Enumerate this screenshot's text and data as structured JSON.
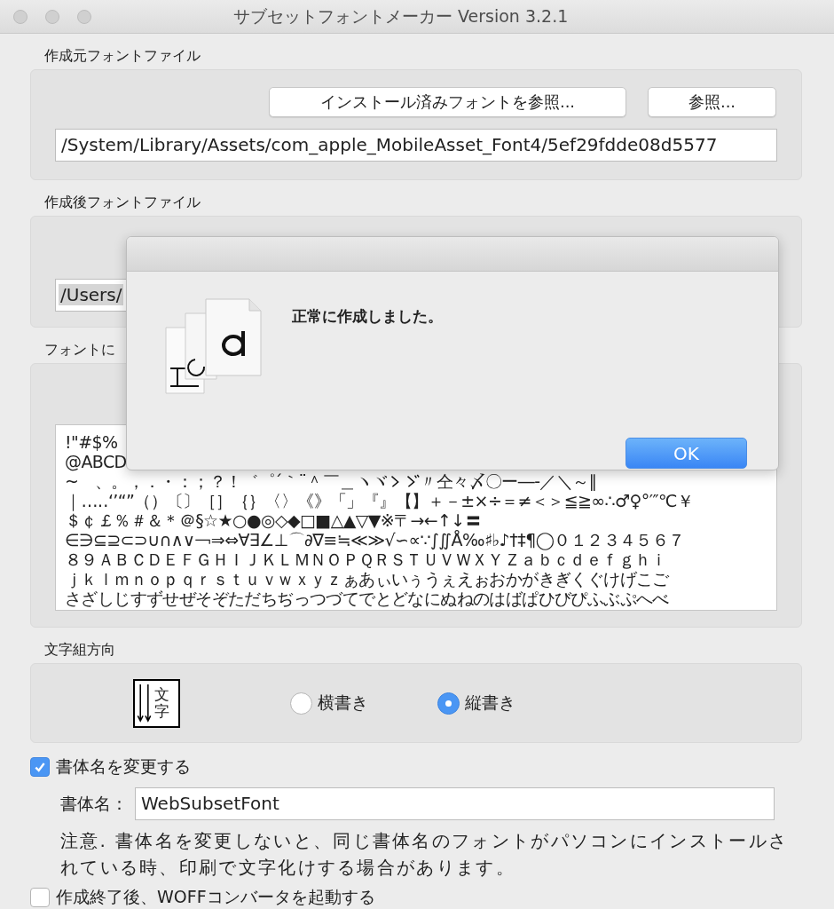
{
  "window": {
    "title": "サブセットフォントメーカー Version 3.2.1"
  },
  "source_section": {
    "label": "作成元フォントファイル",
    "buttons": [
      "インストール済みフォントを参照...",
      "参照..."
    ],
    "path": "/System/Library/Assets/com_apple_MobileAsset_Font4/5ef29fdde08d5577"
  },
  "output_section": {
    "label": "作成後フォントファイル",
    "path": "/Users/"
  },
  "chars_section": {
    "label": "フォントに",
    "lines": [
      "!\"#$%",
      "@ABCD",
      {
        "kind": "split",
        "before": "~　、。，．・：；？！゛゜´｀¨＾￣＿ヽヾ",
        "after": "〃仝々〆〇ー―‐／＼～∥"
      },
      "｜…‥‘’“”（）〔〕［］｛｝〈〉《》「」『』【】＋－±×÷＝≠＜＞≦≧∞∴♂♀°′″℃￥",
      "＄￠￡％＃＆＊＠§☆★○●◎◇◆□■△▲▽▼※〒→←↑↓〓",
      "∈∋⊆⊇⊂⊃∪∩∧∨￢⇒⇔∀∃∠⊥⌒∂∇≡≒≪≫√∽∝∵∫∬Å‰♯♭♪†‡¶◯０１２３４５６７",
      "８９ＡＢＣＤＥＦＧＨＩＪＫＬＭＮＯＰＱＲＳＴＵＶＷＸＹＺａｂｃｄｅｆｇｈｉ",
      "ｊｋｌｍｎｏｐｑｒｓｔｕｖｗｘｙｚぁあぃいぅうぇえぉおかがきぎくぐけげこご",
      "さざしじすずせぜそぞただちぢっつづてでとどなにぬねのはばぱひびぴふぶぷへべ"
    ]
  },
  "direction_section": {
    "label": "文字組方向",
    "sample_text": "文字",
    "options": [
      {
        "label": "横書き",
        "selected": false
      },
      {
        "label": "縦書き",
        "selected": true
      }
    ]
  },
  "rename": {
    "label": "書体名を変更する",
    "checked": true,
    "name_label": "書体名：",
    "name_value": "WebSubsetFont",
    "note": "注意. 書体名を変更しないと、同じ書体名のフォントがパソコンにインストールされている時、印刷で文字化けする場合があります。"
  },
  "woff": {
    "label": "作成終了後、WOFFコンバータを起動する",
    "checked": false
  },
  "dialog": {
    "message": "正常に作成しました。",
    "button": "OK"
  }
}
